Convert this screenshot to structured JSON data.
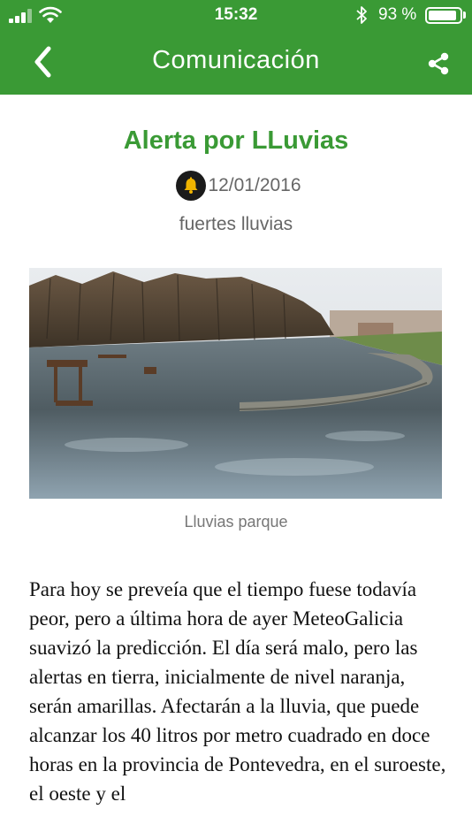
{
  "status_bar": {
    "time": "15:32",
    "battery_percent": "93 %",
    "battery_level": 0.93
  },
  "nav": {
    "title": "Comunicación",
    "back_icon": "chevron-left-icon",
    "share_icon": "share-icon"
  },
  "article": {
    "title": "Alerta por LLuvias",
    "category_icon": "bell-icon",
    "date": "12/01/2016",
    "subtitle": "fuertes lluvias",
    "image_caption": "Lluvias parque",
    "body": "Para hoy se preveía que el tiempo fuese todavía peor, pero a última hora de ayer MeteoGalicia suavizó la predicción. El día será malo, pero las alertas en tierra, inicialmente de nivel naranja, serán amarillas. Afectarán a la lluvia, que puede alcanzar los 40 litros por metro cuadrado en doce horas en la provincia de Pontevedra, en el suroeste, el oeste y el"
  },
  "colors": {
    "brand_green": "#3a9a35",
    "title_green": "#3a9a35",
    "bell_circle": "#1b1b1b",
    "bell_gold": "#f0b400"
  }
}
